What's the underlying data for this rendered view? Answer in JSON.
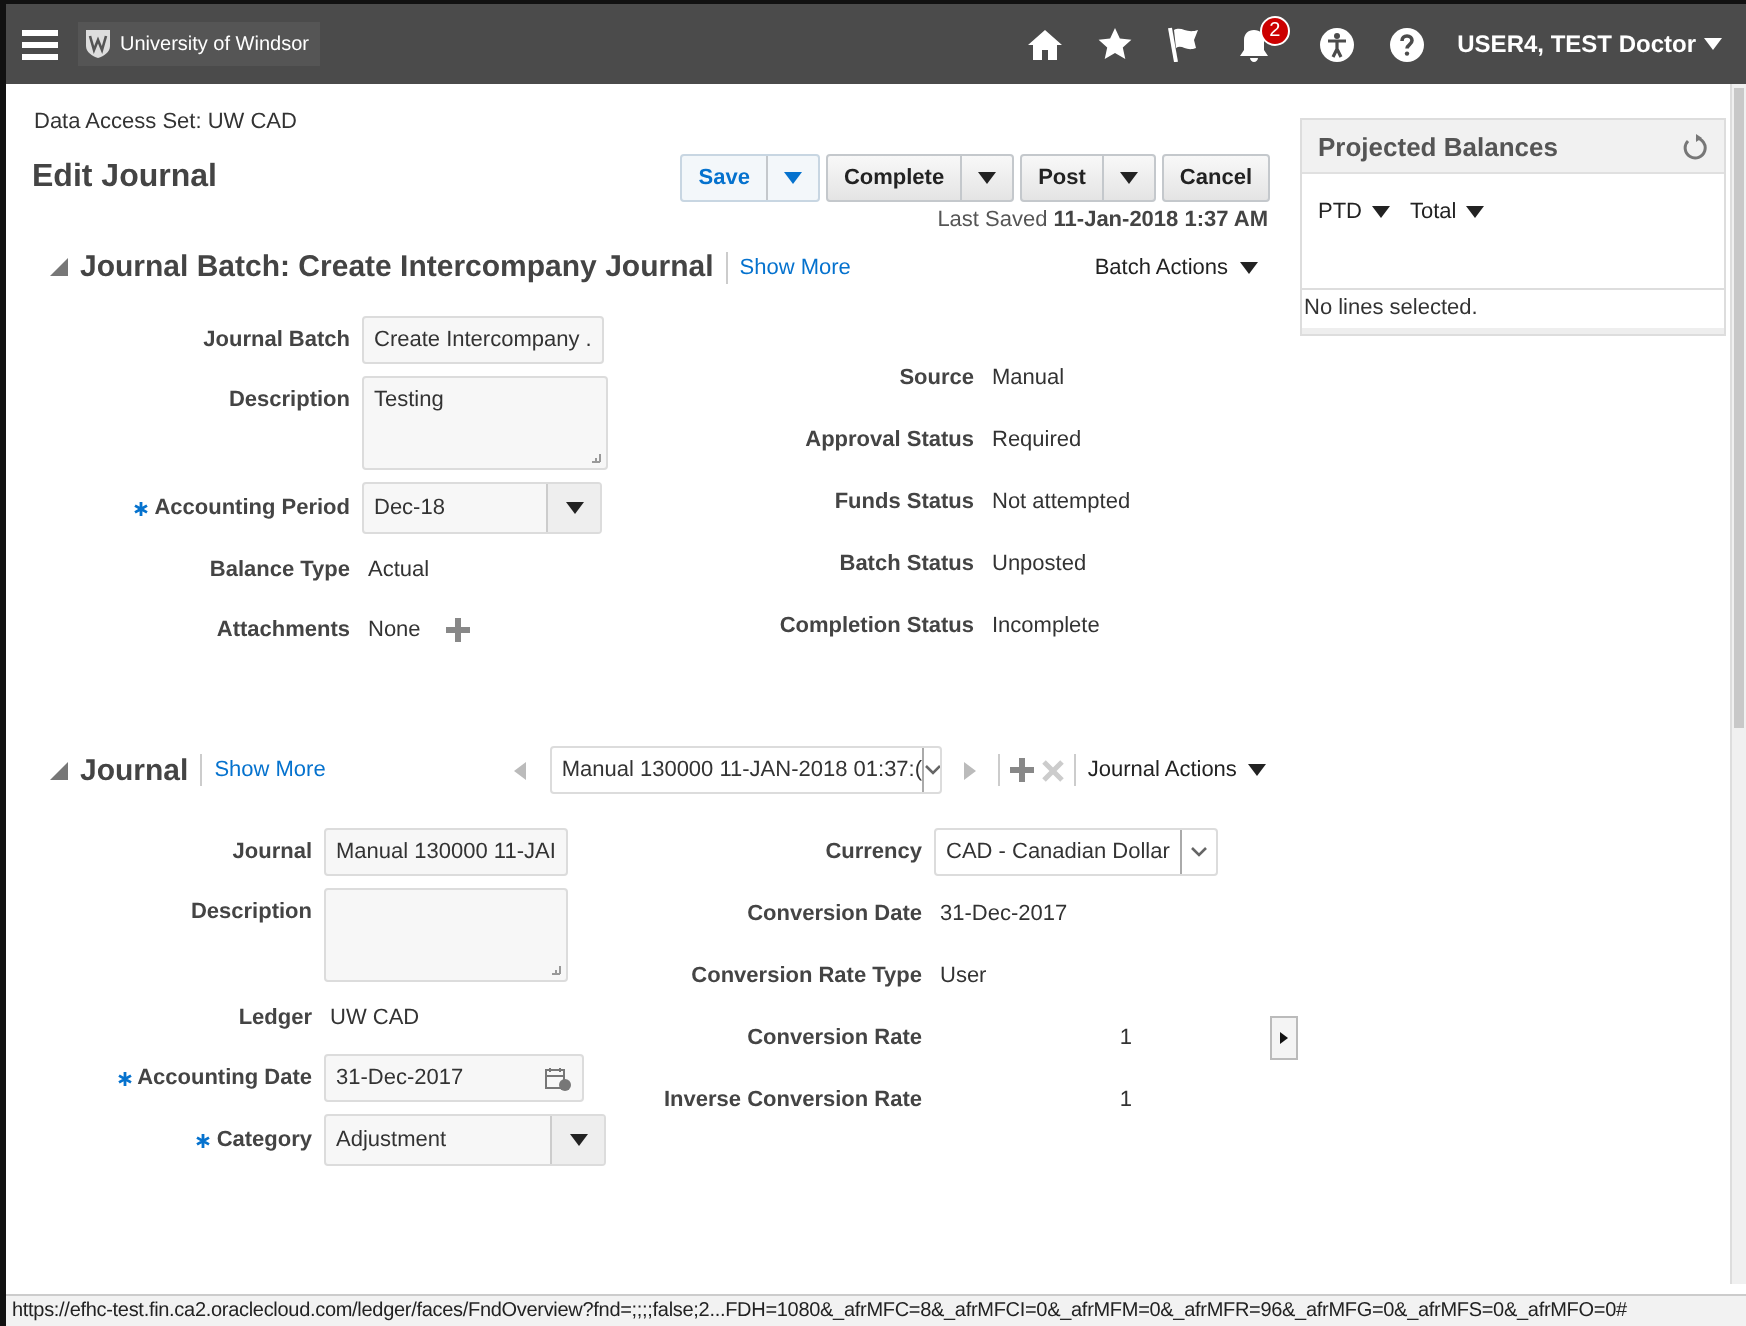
{
  "header": {
    "brand": "University of Windsor",
    "notification_count": "2",
    "user": "USER4, TEST Doctor"
  },
  "data_access": "Data Access Set: UW CAD",
  "title": "Edit Journal",
  "buttons": [
    {
      "label": "Save",
      "kind": "primary"
    },
    {
      "label": "Complete",
      "kind": "split"
    },
    {
      "label": "Post",
      "kind": "split"
    },
    {
      "label": "Cancel",
      "kind": "plain"
    }
  ],
  "last_saved": "Last Saved **11-Jan-2018 1:37 AM**",
  "batch": {
    "title": "Journal Batch: Create Intercompany Journal",
    "expanded": true,
    "show_more": "Show More",
    "actions": "Batch Actions",
    "left_fields": [
      {
        "label": "Journal Batch",
        "kind": "input",
        "value": "Create Intercompany ."
      },
      {
        "label": "Description",
        "kind": "textarea",
        "value": "Testing"
      },
      {
        "label": "Accounting Period",
        "kind": "select",
        "value": "Dec-18",
        "required": true
      },
      {
        "label": "Balance Type",
        "kind": "text",
        "value": "Actual"
      },
      {
        "label": "Attachments",
        "kind": "attachments",
        "value": "None"
      }
    ],
    "right_fields": [
      {
        "label": "Source",
        "kind": "text",
        "value": "Manual"
      },
      {
        "label": "Approval Status",
        "kind": "text",
        "value": "Required"
      },
      {
        "label": "Funds Status",
        "kind": "text",
        "value": "Not attempted"
      },
      {
        "label": "Batch Status",
        "kind": "text",
        "value": "Unposted"
      },
      {
        "label": "Completion Status",
        "kind": "text",
        "value": "Incomplete"
      }
    ]
  },
  "journal": {
    "title": "Journal",
    "expanded": true,
    "show_more": "Show More",
    "navigator": "Manual 130000 11-JAN-2018 01:37:(",
    "actions": "Journal Actions",
    "left_fields": [
      {
        "label": "Journal",
        "kind": "input",
        "value": "Manual 130000 11-JAI"
      },
      {
        "label": "Description",
        "kind": "textarea"
      },
      {
        "label": "Ledger",
        "kind": "text",
        "value": "UW CAD"
      },
      {
        "label": "Accounting Date",
        "kind": "date",
        "value": "31-Dec-2017",
        "required": true
      },
      {
        "label": "Category",
        "kind": "select",
        "value": "Adjustment",
        "required": true
      }
    ],
    "right_fields": [
      {
        "label": "Currency",
        "kind": "combo",
        "value": "CAD - Canadian Dollar"
      },
      {
        "label": "Conversion Date",
        "kind": "text",
        "value": "31-Dec-2017"
      },
      {
        "label": "Conversion Rate Type",
        "kind": "text",
        "value": "User"
      },
      {
        "label": "Conversion Rate",
        "kind": "number",
        "value": "1"
      },
      {
        "label": "Inverse Conversion Rate",
        "kind": "number_plain",
        "value": "1"
      }
    ]
  },
  "projected_balances": {
    "title": "Projected Balances",
    "menus": [
      "PTD",
      "Total"
    ],
    "empty_text": "No lines selected."
  },
  "status_url": "https://efhc-test.fin.ca2.oraclecloud.com/ledger/faces/FndOverview?fnd=;;;;false;2...FDH=1080&_afrMFC=8&_afrMFCI=0&_afrMFM=0&_afrMFR=96&_afrMFG=0&_afrMFS=0&_afrMFO=0#"
}
